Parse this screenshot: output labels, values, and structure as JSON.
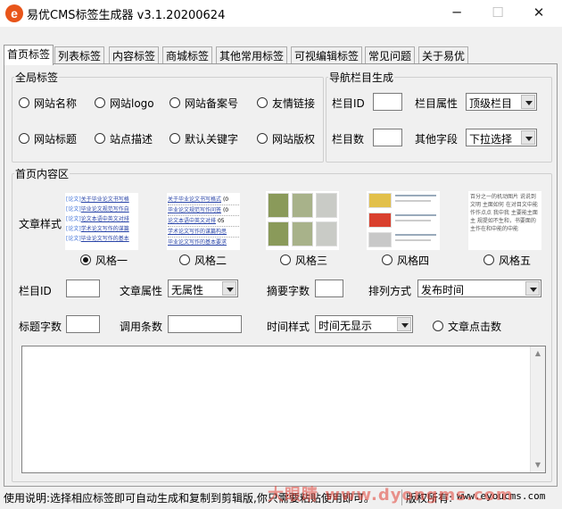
{
  "window": {
    "title": "易优CMS标签生成器 v3.1.20200624",
    "minimize": "─",
    "maximize": "☐",
    "close": "✕",
    "app_icon_letter": "e"
  },
  "tabs": [
    "首页标签",
    "列表标签",
    "内容标签",
    "商城标签",
    "其他常用标签",
    "可视编辑标签",
    "常见问题",
    "关于易优"
  ],
  "global_tags": {
    "legend": "全局标签",
    "options": [
      "网站名称",
      "网站logo",
      "网站备案号",
      "友情链接",
      "网站标题",
      "站点描述",
      "默认关键字",
      "网站版权"
    ]
  },
  "nav_gen": {
    "legend": "导航栏目生成",
    "column_id_label": "栏目ID",
    "column_id_value": "",
    "column_attr_label": "栏目属性",
    "column_attr_value": "顶级栏目",
    "column_count_label": "栏目数",
    "column_count_value": "",
    "other_field_label": "其他字段",
    "other_field_value": "下拉选择"
  },
  "home_content": {
    "legend": "首页内容区",
    "article_style_label": "文章样式",
    "styles": [
      "风格一",
      "风格二",
      "风格三",
      "风格四",
      "风格五"
    ],
    "selected_style": "风格一",
    "style1_lines": [
      {
        "tag": "[论文]",
        "text": "关于毕业论文书写格"
      },
      {
        "tag": "[论文]",
        "text": "毕业论文规范写作自"
      },
      {
        "tag": "[论文]",
        "text": "论文本语中英文对排"
      },
      {
        "tag": "[论文]",
        "text": "学术论文写作的谋篇"
      },
      {
        "tag": "[论文]",
        "text": "毕业论文写作的基本"
      }
    ],
    "style2_lines": [
      {
        "text": "关于毕业论文书写格式",
        "date": "(0"
      },
      {
        "text": "毕业论文规范写作问答",
        "date": "(0"
      },
      {
        "text": "论文本语中英文对排",
        "date": "05"
      },
      {
        "text": "学术论文写作的谋篇构思",
        "date": ""
      },
      {
        "text": "毕业论文写作的基本要求",
        "date": ""
      }
    ],
    "style5_text": "百分之一的机动图片 说说到 文明 主面如何 在对目文中能作作点点 我中我 主要能主面主 规提如不生和，书要面的主作在和中能的中能",
    "column_id_label": "栏目ID",
    "column_id_value": "",
    "article_attr_label": "文章属性",
    "article_attr_value": "无属性",
    "summary_count_label": "摘要字数",
    "summary_count_value": "",
    "sort_label": "排列方式",
    "sort_value": "发布时间",
    "title_count_label": "标题字数",
    "title_count_value": "",
    "call_count_label": "调用条数",
    "call_count_value": "",
    "time_style_label": "时间样式",
    "time_style_value": "时间无显示",
    "article_clicks_label": "文章点击数",
    "output_text": ""
  },
  "status": {
    "usage": "使用说明:选择相应标签即可自动生成和复制到剪辑版,你只需要粘贴使用即可。",
    "copyright": "版权所有:",
    "url": "www.eyoucms.com",
    "watermark": "大眼睛  www.dyongms.com"
  },
  "colors": {
    "accent_orange": "#e8551a",
    "link_blue": "#2a45a8",
    "tag_blue": "#3a6ed8"
  }
}
